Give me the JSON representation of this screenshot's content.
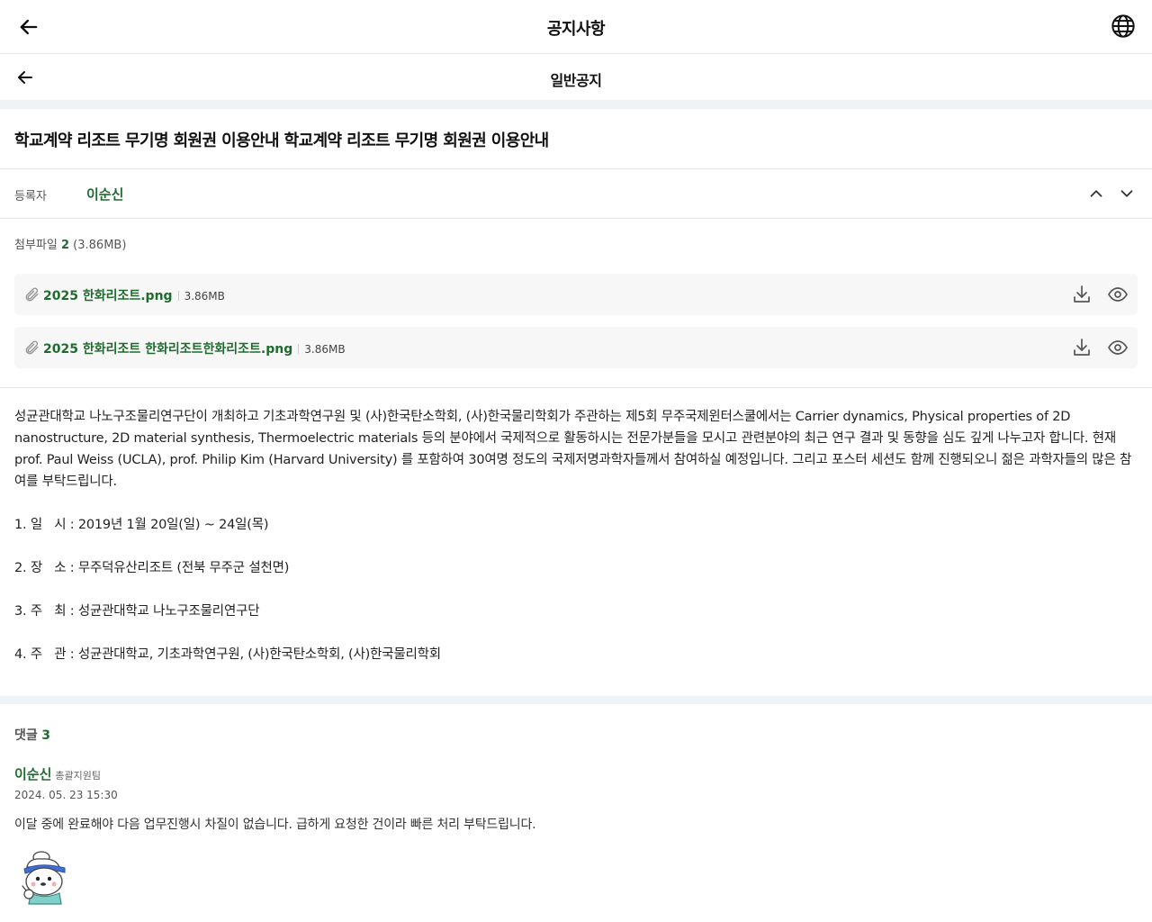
{
  "header": {
    "title": "공지사항",
    "back_icon": "arrow-left-icon",
    "lang_icon": "globe-icon"
  },
  "subheader": {
    "title": "일반공지",
    "back_icon": "arrow-left-icon"
  },
  "post": {
    "title": "학교계약 리조트 무기명 회원권 이용안내 학교계약 리조트 무기명 회원권 이용안내",
    "author_label": "등록자",
    "author_name": "이순신",
    "attachments": {
      "label": "첨부파일",
      "count": "2",
      "total_size": "(3.86MB)",
      "files": [
        {
          "name": "2025 한화리조트.png",
          "size": "3.86MB"
        },
        {
          "name": "2025 한화리조트 한화리조트한화리조트.png",
          "size": "3.86MB"
        }
      ]
    },
    "body": "성균관대학교 나노구조물리연구단이 개최하고 기초과학연구원 및 (사)한국탄소학회, (사)한국물리학회가 주관하는 제5회 무주국제윈터스쿨에서는 Carrier dynamics, Physical properties of 2D nanostructure, 2D material synthesis, Thermoelectric materials 등의 분야에서 국제적으로 활동하시는 전문가분들을 모시고 관련분야의 최근 연구 결과 및 동향을 심도 깊게 나누고자 합니다. 현재 prof. Paul Weiss (UCLA), prof. Philip Kim (Harvard University) 를 포함하여 30여명 정도의 국제저명과학자들께서 참여하실 예정입니다. 그리고 포스터 세션도 함께 진행되오니 젊은 과학자들의 많은 참여를 부탁드립니다.",
    "items": [
      "1. 일   시 : 2019년 1월 20일(일) ~ 24일(목)",
      "2. 장   소 : 무주덕유산리조트 (전북 무주군 설천면)",
      "3. 주   최 : 성균관대학교 나노구조물리연구단",
      "4. 주   관 : 성균관대학교, 기초과학연구원, (사)한국탄소학회, (사)한국물리학회"
    ]
  },
  "comments": {
    "label": "댓글",
    "count": "3",
    "list": [
      {
        "author": "이순신",
        "team": "총괄지원팀",
        "date": "2024. 05. 23 15:30",
        "text": "이달 중에 완료해야 다음 업무진행시 차질이 없습니다. 급하게 요청한 건이라 빠른 처리 부탁드립니다."
      }
    ]
  },
  "colors": {
    "accent": "#1f6b2f",
    "band": "#eef3f8",
    "file_bg": "#f7f7f7"
  }
}
